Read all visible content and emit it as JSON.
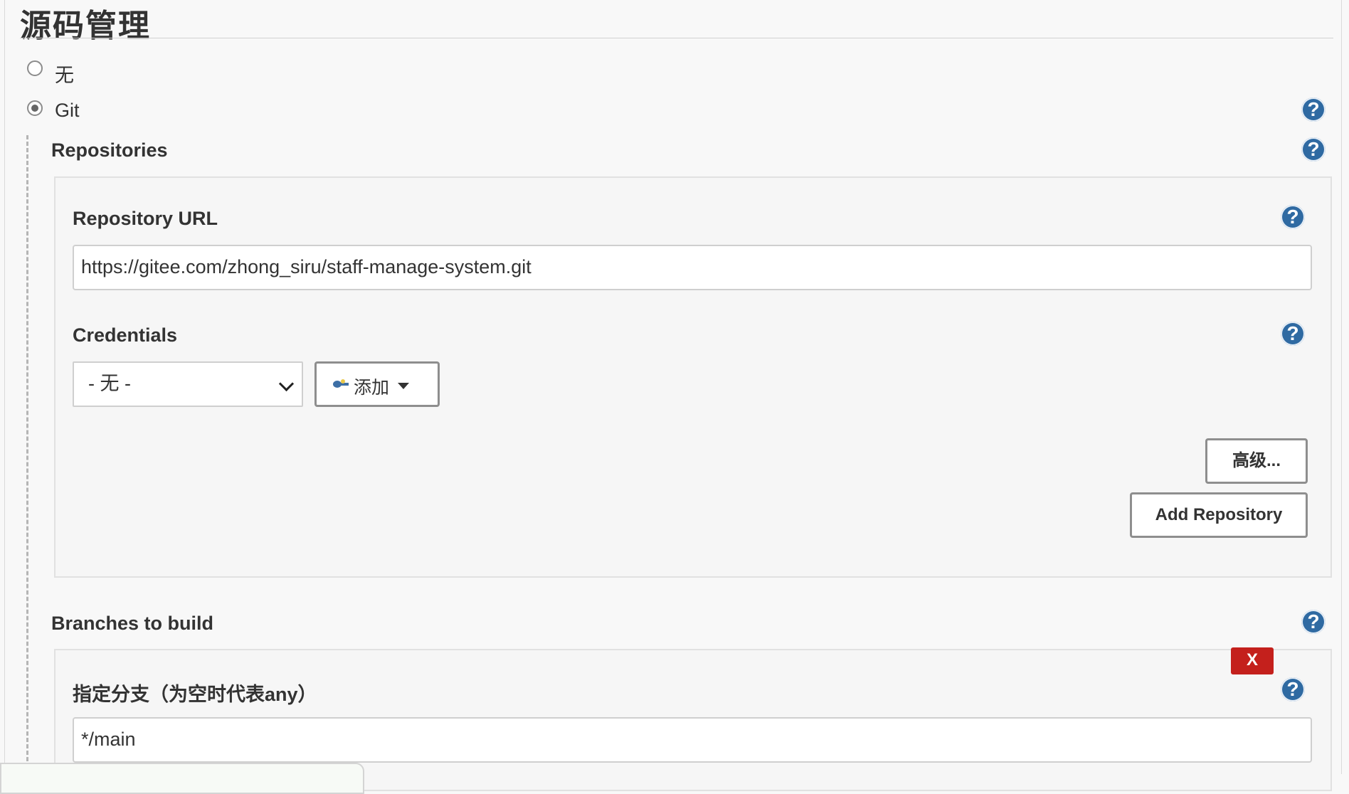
{
  "section_title": "源码管理",
  "scm_options": [
    {
      "label": "无",
      "checked": false
    },
    {
      "label": "Git",
      "checked": true
    }
  ],
  "repositories": {
    "label": "Repositories",
    "url_label": "Repository URL",
    "url_value": "https://gitee.com/zhong_siru/staff-manage-system.git",
    "credentials_label": "Credentials",
    "credentials_selected": "- 无 -",
    "add_button": "添加",
    "advanced_button": "高级...",
    "add_repository_button": "Add Repository"
  },
  "branches": {
    "label": "Branches to build",
    "specifier_label": "指定分支（为空时代表any）",
    "specifier_value": "*/main",
    "delete_label": "X"
  },
  "help_icon_text": "?",
  "colors": {
    "help": "#2f6aa2",
    "delete": "#c4201c",
    "background": "#f8f8f8"
  }
}
